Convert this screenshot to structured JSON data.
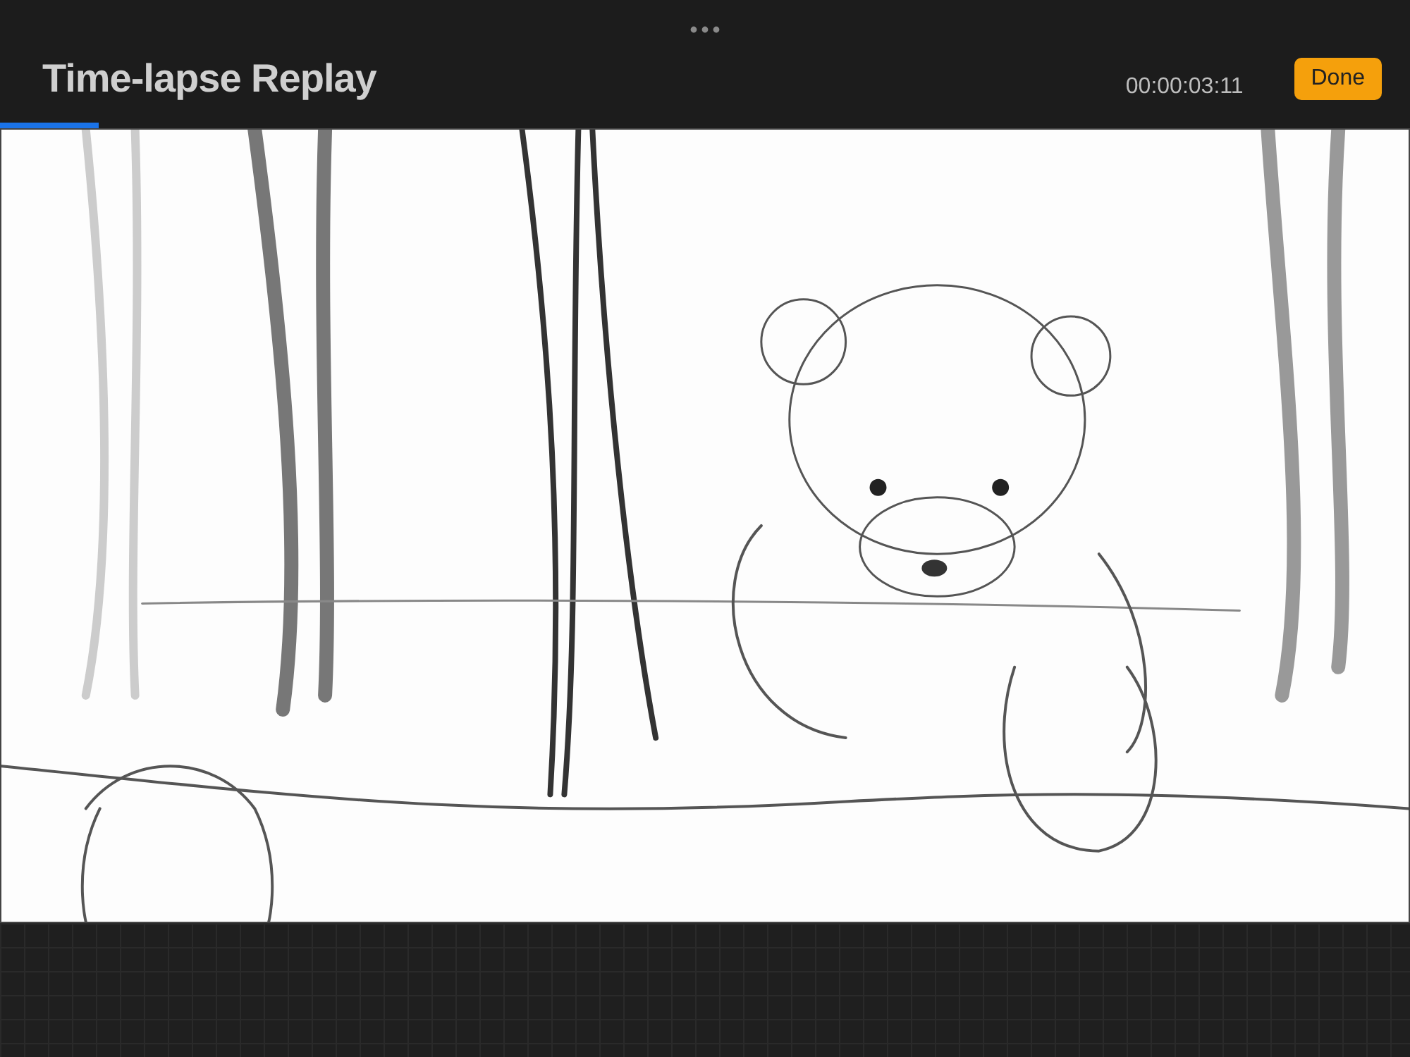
{
  "header": {
    "title": "Time-lapse Replay",
    "elapsed": "00:00:03:11",
    "done_button": "Done"
  },
  "progress": {
    "level": 0.07
  }
}
